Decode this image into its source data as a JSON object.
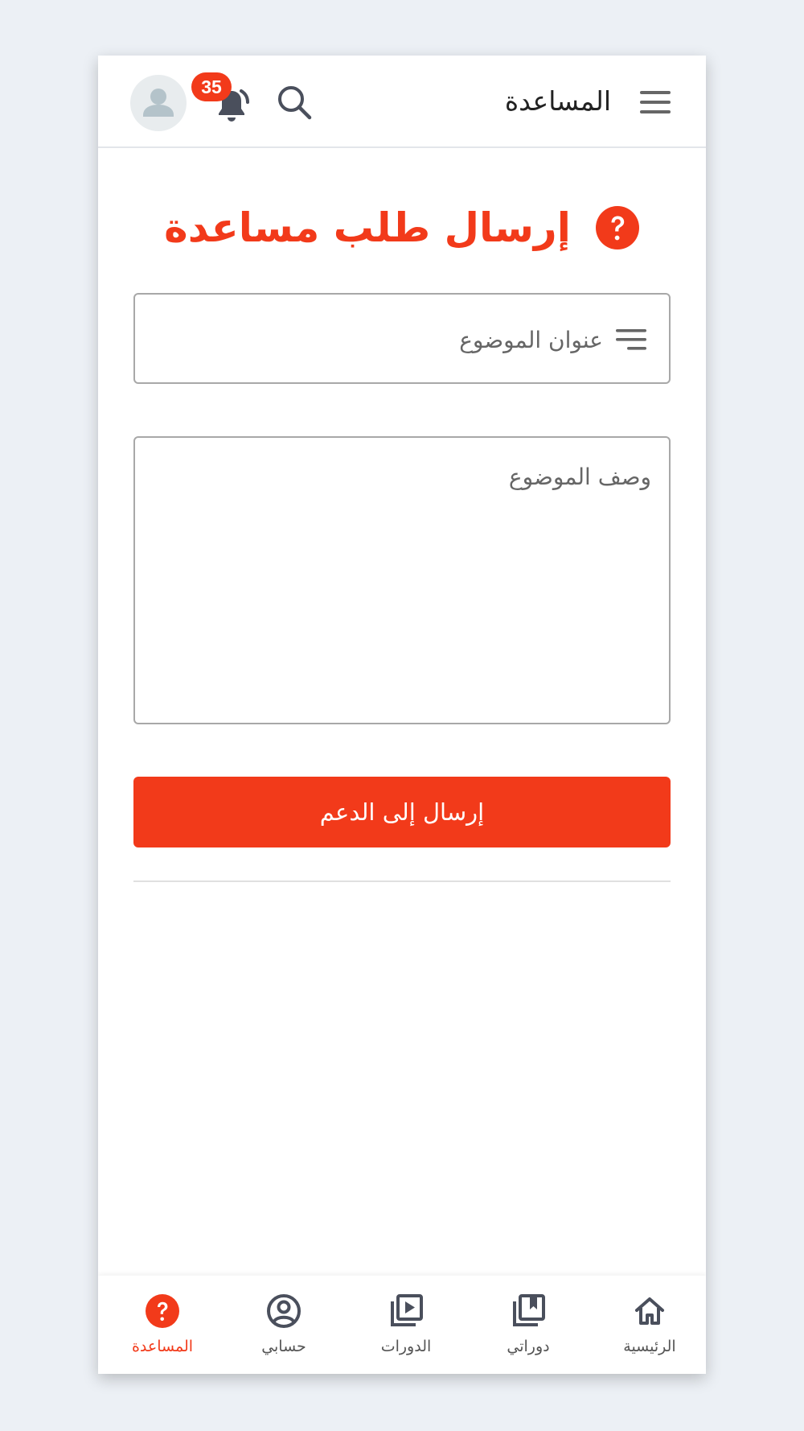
{
  "header": {
    "title": "المساعدة",
    "notification_count": "35",
    "icons": [
      "menu-icon",
      "search-icon",
      "bell-icon",
      "user-avatar-icon"
    ]
  },
  "main": {
    "title": "إرسال طلب مساعدة",
    "subject_placeholder": "عنوان الموضوع",
    "subject_value": "",
    "description_placeholder": "وصف الموضوع",
    "description_value": "",
    "submit_label": "إرسال إلى الدعم"
  },
  "bottom_nav": {
    "items": [
      {
        "label": "الرئيسية",
        "icon": "home-icon",
        "active": false
      },
      {
        "label": "دوراتي",
        "icon": "bookmark-library-icon",
        "active": false
      },
      {
        "label": "الدورات",
        "icon": "video-library-icon",
        "active": false
      },
      {
        "label": "حسابي",
        "icon": "account-circle-icon",
        "active": false
      },
      {
        "label": "المساعدة",
        "icon": "help-icon",
        "active": true
      }
    ]
  },
  "colors": {
    "accent": "#f23a1a",
    "background": "#ecf0f5",
    "icon_dark": "#4a4f5c"
  }
}
